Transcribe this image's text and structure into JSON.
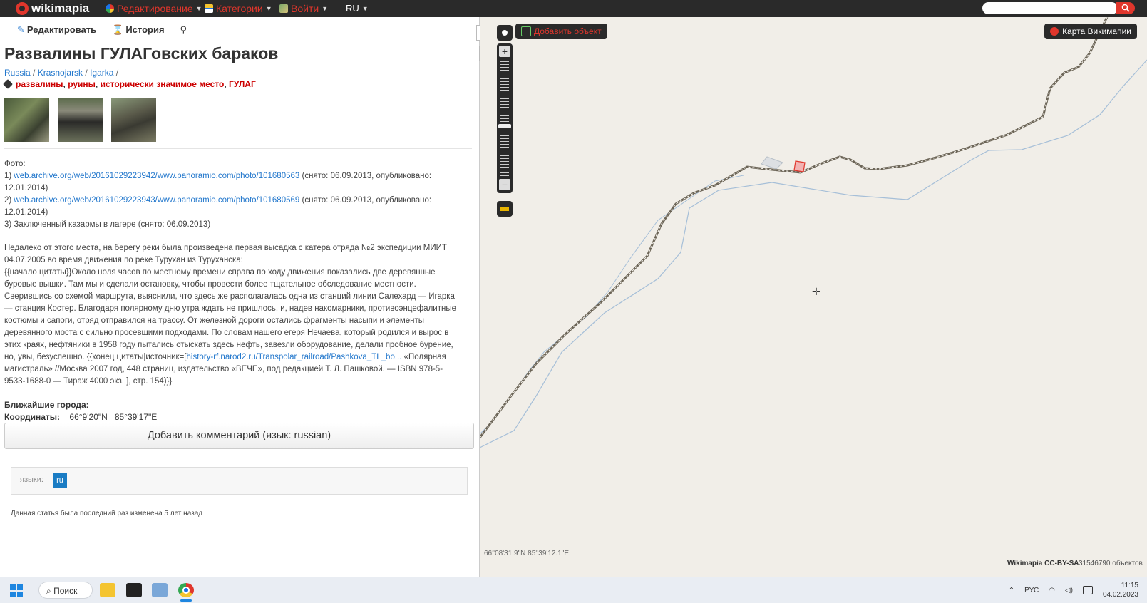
{
  "topbar": {
    "logo_text": "wikimapia",
    "menu_edit": "Редактирование",
    "menu_categories": "Категории",
    "menu_login": "Войти",
    "menu_lang": "RU",
    "search_placeholder": ""
  },
  "toolbar": {
    "edit_label": "Редактировать",
    "history_label": "История"
  },
  "article": {
    "title": "Развалины ГУЛАГовских бараков",
    "breadcrumbs": [
      "Russia",
      "Krasnojarsk",
      "Igarka"
    ],
    "tags": [
      "развалины",
      "руины",
      "исторически значимое место",
      "ГУЛАГ"
    ],
    "photos_heading": "Фото:",
    "photo1_prefix": "1) ",
    "photo1_link": "web.archive.org/web/20161029223942/www.panoramio.com/photo/101680563",
    "photo1_suffix": " (снято: 06.09.2013, опубликовано: 12.01.2014)",
    "photo2_prefix": "2) ",
    "photo2_link": "web.archive.org/web/20161029223943/www.panoramio.com/photo/101680569",
    "photo2_suffix": " (снято: 06.09.2013, опубликовано: 12.01.2014)",
    "photo3": "3) Заключенный казармы в лагере (снято: 06.09.2013)",
    "para_intro": "Недалеко от этого места, на берегу реки была произведена первая высадка с катера отряда №2 экспедиции МИИТ 04.07.2005 во время движения по реке Турухан из Туруханска:",
    "para_quote_a": "{{начало цитаты}}Около ноля часов по местному времени справа по ходу движения показались две деревянные буровые вышки. Там мы и сделали остановку, чтобы провести более тщательное обследование местности. Сверившись со схемой маршрута, выяснили, что здесь же располагалась одна из станций линии Салехард — Игарка — станция Костер. Благодаря полярному дню утра ждать не пришлось, и, надев накомарники, противоэнцефалитные костюмы и сапоги, отряд отправился на трассу. От железной дороги остались фрагменты насыпи и элементы деревянного моста с сильно просевшими подходами. По словам нашего егеря Нечаева, который родился и вырос в этих краях, нефтяники в 1958 году пытались отыскать здесь нефть, завезли оборудование, делали пробное бурение, но, увы, безуспешно. {{конец цитаты|источник=[",
    "para_quote_link": "history-rf.narod2.ru/Transpolar_railroad/Pashkova_TL_bo...",
    "para_quote_b": " «Полярная магистраль» //Москва 2007 год, 448 страниц, издательство «ВЕЧЕ», под редакцией Т. Л. Пашковой. — ISBN 978-5-9533-1688-0 — Тираж 4000 экз. ], стр. 154)}}",
    "nearest_cities": "Ближайшие города:",
    "coords_label": "Координаты:",
    "coords_lat": "66°9'20\"N",
    "coords_lon": "85°39'17\"E",
    "add_comment": "Добавить комментарий (язык: russian)",
    "langs_label": "языки:",
    "lang_ru": "ru",
    "last_modified": "Данная статья была последний раз изменена 5 лет назад"
  },
  "map": {
    "add_object": "Добавить объект",
    "wiki_map": "Карта Викимапии",
    "cursor_coords": "66°08'31.9\"N 85°39'12.1\"E",
    "copyright": "Wikimapia CC-BY-SA",
    "objects_count": "31546790 объектов"
  },
  "taskbar": {
    "search_label": "Поиск",
    "lang": "РУС",
    "time": "11:15",
    "date": "04.02.2023"
  },
  "colors": {
    "brand_red": "#e0362c",
    "link_blue": "#2277cc",
    "bar_dark": "#2a2a2a",
    "map_bg": "#f1eee8"
  }
}
